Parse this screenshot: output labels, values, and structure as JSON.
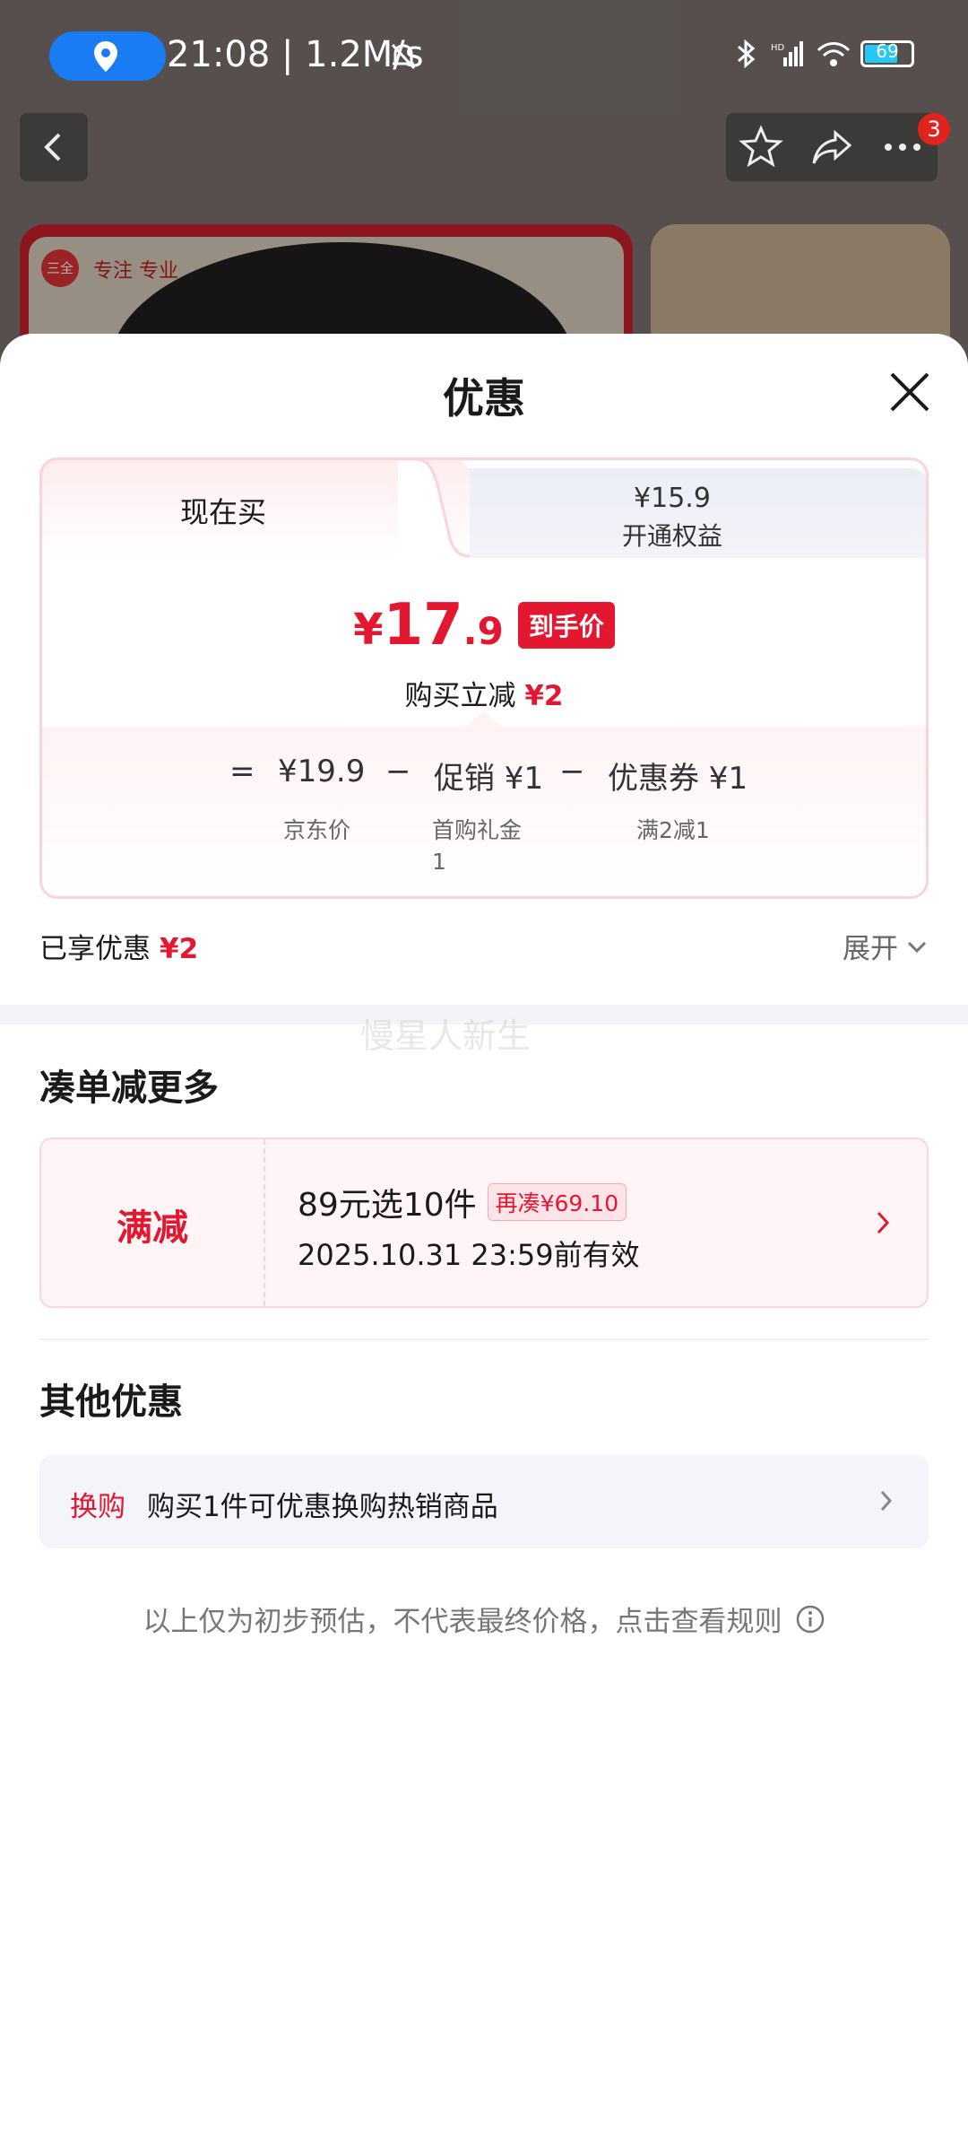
{
  "status_bar": {
    "time": "21:08 | 1.2M/s",
    "battery": "69"
  },
  "background": {
    "brand_logo": "三全",
    "brand_text": "专注 专业",
    "cart_badge": "3"
  },
  "sheet": {
    "title": "优惠",
    "tabs": [
      {
        "label": "现在买"
      },
      {
        "price": "¥15.9",
        "label": "开通权益"
      }
    ],
    "final_price": {
      "currency": "¥",
      "integer": "17",
      "decimal": ".9",
      "tag": "到手价"
    },
    "instant_reduce": {
      "label": "购买立减",
      "amount": "¥2"
    },
    "breakdown": {
      "equals": "=",
      "jd_price": "¥19.9",
      "jd_label": "京东价",
      "minus1": "−",
      "promo": "促销 ¥1",
      "promo_label_line1": "首购礼金",
      "promo_label_line2": "1",
      "minus2": "−",
      "coupon": "优惠券 ¥1",
      "coupon_label": "满2减1"
    },
    "enjoyed": {
      "label": "已享优惠",
      "amount": "¥2"
    },
    "expand_label": "展开",
    "watermark": "慢星人新生",
    "more_section": {
      "title": "凑单减更多",
      "card": {
        "type": "满减",
        "title": "89元选10件",
        "tag": "再凑¥69.10",
        "valid": "2025.10.31 23:59前有效"
      }
    },
    "other_section": {
      "title": "其他优惠",
      "item": {
        "tag": "换购",
        "text": "购买1件可优惠换购热销商品"
      }
    },
    "note": "以上仅为初步预估，不代表最终价格，点击查看规则"
  },
  "colors": {
    "accent_red": "#e3172f",
    "status_blue": "#1a7cf2"
  }
}
